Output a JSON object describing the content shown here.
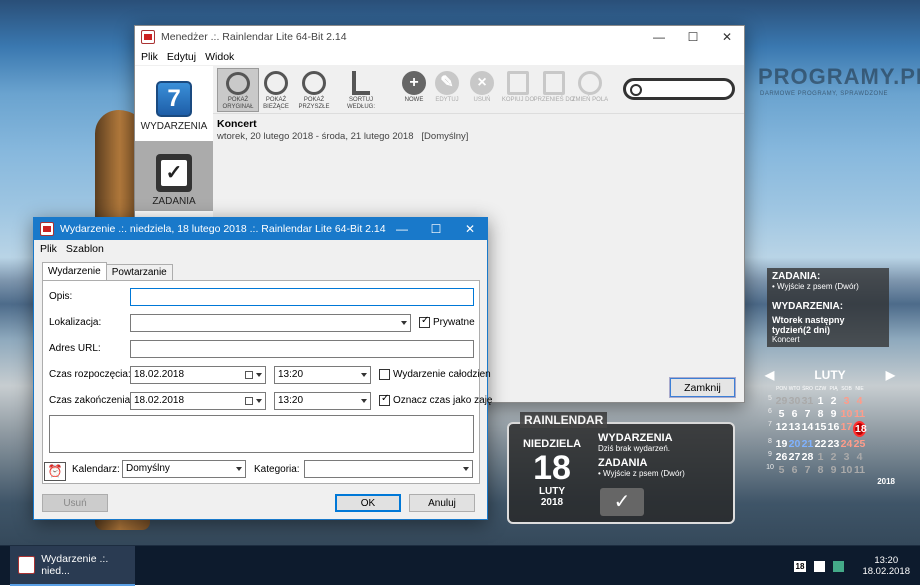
{
  "manager": {
    "title": "Menedżer .:. Rainlendar Lite 64-Bit 2.14",
    "menu": [
      "Plik",
      "Edytuj",
      "Widok"
    ],
    "sidebar": [
      {
        "label": "WYDARZENIA",
        "icon": "calendar-7-icon"
      },
      {
        "label": "ZADANIA",
        "icon": "clipboard-check-icon"
      }
    ],
    "calendar_icon_num": "7",
    "toolbar": [
      {
        "label": "POKAŻ ORYGINAŁ",
        "icon": "show-original-icon"
      },
      {
        "label": "POKAŻ BIEŻĄCE",
        "icon": "show-current-icon"
      },
      {
        "label": "POKAŻ PRZYSZŁE",
        "icon": "show-future-icon"
      },
      {
        "label": "SORTUJ WEDŁUG:",
        "icon": "sort-icon"
      },
      {
        "label": "NOWE",
        "icon": "plus-icon"
      },
      {
        "label": "EDYTUJ",
        "icon": "edit-icon"
      },
      {
        "label": "USUŃ",
        "icon": "delete-icon"
      },
      {
        "label": "KOPIUJ DO",
        "icon": "copy-icon"
      },
      {
        "label": "PRZENIEŚ DO",
        "icon": "move-icon"
      },
      {
        "label": "ZMIEŃ POLA",
        "icon": "fields-icon"
      }
    ],
    "search_placeholder": "",
    "event": {
      "title": "Koncert",
      "date": "wtorek, 20 lutego 2018 - środa, 21 lutego 2018",
      "calendar": "[Domyślny]"
    },
    "close_label": "Zamknij"
  },
  "dialog": {
    "title": "Wydarzenie .:. niedziela, 18 lutego 2018 .:. Rainlendar Lite 64-Bit 2.14",
    "menu": [
      "Plik",
      "Szablon"
    ],
    "tabs": [
      "Wydarzenie",
      "Powtarzanie"
    ],
    "labels": {
      "opis": "Opis:",
      "lokalizacja": "Lokalizacja:",
      "url": "Adres URL:",
      "start": "Czas rozpoczęcia:",
      "end": "Czas zakończenia:",
      "kalendarz": "Kalendarz:",
      "kategoria": "Kategoria:"
    },
    "values": {
      "opis": "",
      "lokalizacja": "",
      "url": "",
      "start_date": "18.02.2018",
      "start_time": "13:20",
      "end_date": "18.02.2018",
      "end_time": "13:20",
      "kalendarz": "Domyślny",
      "kategoria": ""
    },
    "checks": {
      "prywatne": "Prywatne",
      "calodzienne": "Wydarzenie całodzien",
      "oznacz": "Oznacz czas jako zaję"
    },
    "buttons": {
      "usun": "Usuń",
      "ok": "OK",
      "anuluj": "Anuluj"
    }
  },
  "rainlendar": {
    "header": "RAINLENDAR",
    "weekday": "NIEDZIELA",
    "day": "18",
    "month": "LUTY",
    "year": "2018",
    "events_label": "WYDARZENIA",
    "events_text": "Dziś brak wydarzeń.",
    "tasks_label": "ZADANIA",
    "tasks_text": "• Wyjście z psem (Dwór)"
  },
  "side_panel": {
    "tasks_label": "ZADANIA:",
    "task": "• Wyjście z psem (Dwór)",
    "events_label": "WYDARZENIA:",
    "events_heading": "Wtorek następny tydzień(2 dni)",
    "event": "Koncert"
  },
  "mini_cal": {
    "month": "LUTY",
    "year": "2018",
    "weekdays": [
      "PON",
      "WTO",
      "ŚRO",
      "CZW",
      "PIĄ",
      "SOB",
      "NIE"
    ],
    "weeks": [
      {
        "wk": "5",
        "days": [
          "29",
          "30",
          "31",
          "1",
          "2",
          "3",
          "4"
        ]
      },
      {
        "wk": "6",
        "days": [
          "5",
          "6",
          "7",
          "8",
          "9",
          "10",
          "11"
        ]
      },
      {
        "wk": "7",
        "days": [
          "12",
          "13",
          "14",
          "15",
          "16",
          "17",
          "18"
        ]
      },
      {
        "wk": "8",
        "days": [
          "19",
          "20",
          "21",
          "22",
          "23",
          "24",
          "25"
        ]
      },
      {
        "wk": "9",
        "days": [
          "26",
          "27",
          "28",
          "1",
          "2",
          "3",
          "4"
        ]
      },
      {
        "wk": "10",
        "days": [
          "5",
          "6",
          "7",
          "8",
          "9",
          "10",
          "11"
        ]
      }
    ],
    "today": "18"
  },
  "watermark": {
    "text": "PROGRAMY.PL",
    "sub": "DARMOWE PROGRAMY, SPRAWDZONE"
  },
  "taskbar": {
    "app_label": "Wydarzenie .:. nied...",
    "time": "13:20",
    "date": "18.02.2018",
    "tray_day": "18"
  }
}
